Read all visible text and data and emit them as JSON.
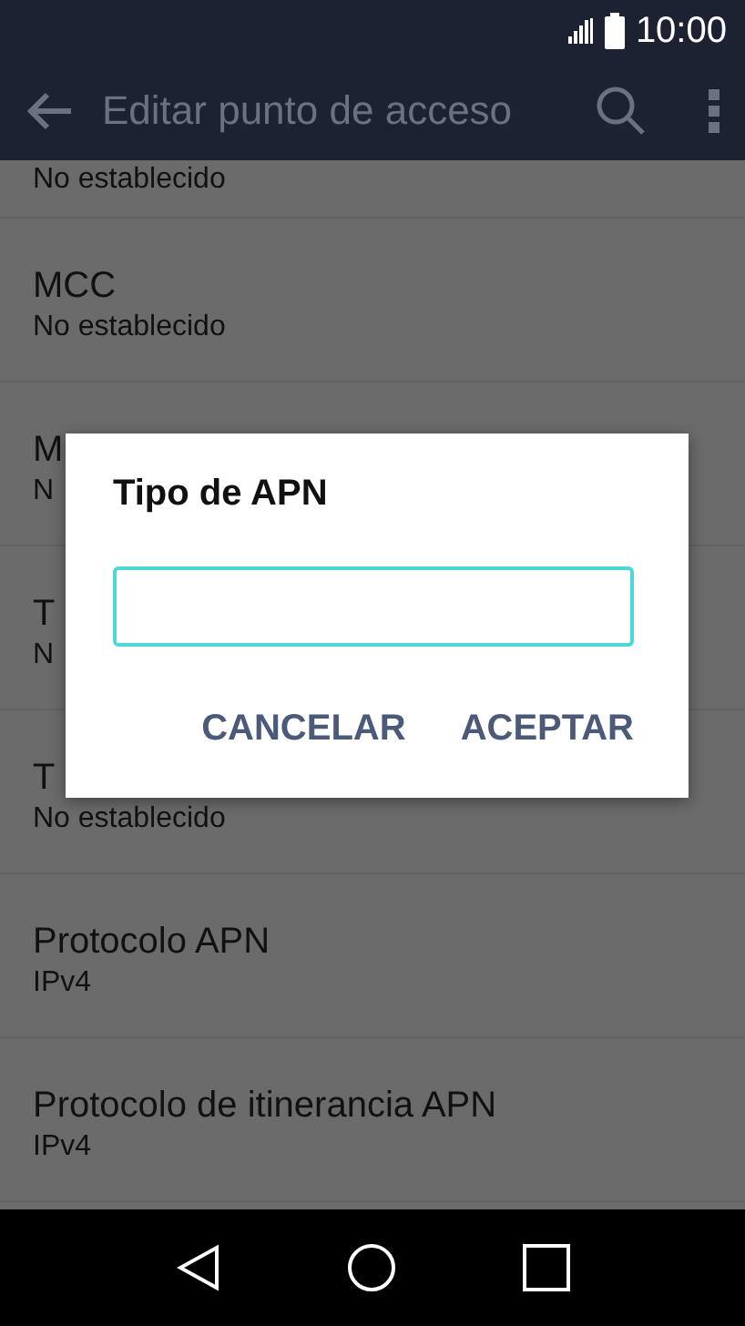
{
  "status_bar": {
    "time": "10:00"
  },
  "app_bar": {
    "title": "Editar punto de acceso"
  },
  "settings": [
    {
      "subtitle": "No establecido"
    },
    {
      "title": "MCC",
      "subtitle": "No establecido"
    },
    {
      "title": "M",
      "subtitle": "N"
    },
    {
      "title": "T",
      "subtitle": "N"
    },
    {
      "title": "T",
      "subtitle": "No establecido"
    },
    {
      "title": "Protocolo APN",
      "subtitle": "IPv4"
    },
    {
      "title": "Protocolo de itinerancia APN",
      "subtitle": "IPv4"
    }
  ],
  "dialog": {
    "title": "Tipo de APN",
    "field": {
      "focused": true
    },
    "buttons": [
      "CANCELAR",
      "ACEPTAR"
    ]
  }
}
